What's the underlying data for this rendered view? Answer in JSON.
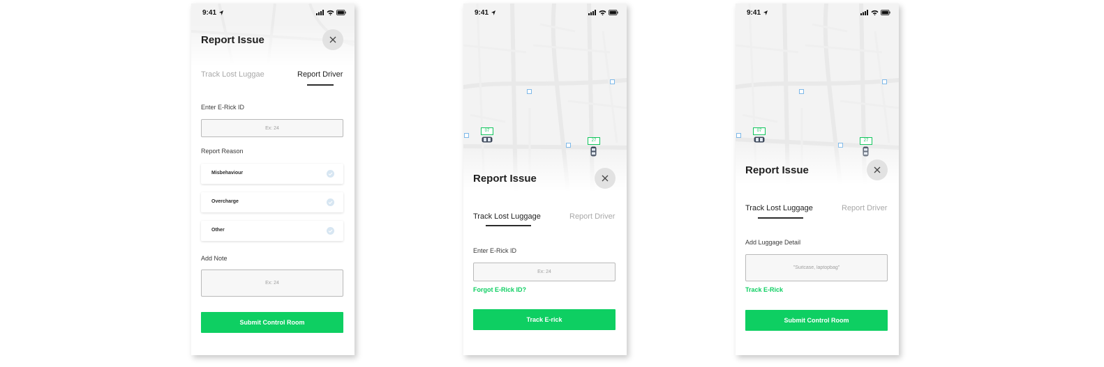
{
  "status_bar": {
    "time": "9:41"
  },
  "screen1": {
    "title": "Report Issue",
    "tabs": [
      {
        "label": "Track Lost Luggae",
        "active": false
      },
      {
        "label": "Report Driver",
        "active": true
      }
    ],
    "erick_id": {
      "label": "Enter E-Rick ID",
      "placeholder": "Ex: 24",
      "value": ""
    },
    "reason": {
      "label": "Report Reason",
      "options": [
        {
          "label": "Misbehaviour"
        },
        {
          "label": "Overcharge"
        },
        {
          "label": "Other"
        }
      ]
    },
    "note": {
      "label": "Add Note",
      "placeholder": "Ex: 24",
      "value": ""
    },
    "submit_label": "Submit Control Room"
  },
  "screen2": {
    "map_markers": [
      {
        "label": "07"
      },
      {
        "label": "27"
      }
    ],
    "title": "Report Issue",
    "tabs": [
      {
        "label": "Track Lost Luggage",
        "active": true
      },
      {
        "label": "Report Driver",
        "active": false
      }
    ],
    "erick_id": {
      "label": "Enter E-Rick ID",
      "placeholder": "Ex: 24",
      "value": ""
    },
    "forgot_link": "Forgot E-Rick ID?",
    "track_label": "Track E-rick"
  },
  "screen3": {
    "map_markers": [
      {
        "label": "07"
      },
      {
        "label": "27"
      }
    ],
    "title": "Report Issue",
    "tabs": [
      {
        "label": "Track Lost Luggage",
        "active": true
      },
      {
        "label": "Report Driver",
        "active": false
      }
    ],
    "luggage": {
      "label": "Add Luggage Detail",
      "placeholder": "\"Suitcase, laptopbag\"",
      "value": ""
    },
    "track_link": "Track E-Rick",
    "submit_label": "Submit Control Room"
  },
  "colors": {
    "accent_green": "#0ecf62",
    "close_bg": "#e2e2e2",
    "text_dark": "#1e1e1e",
    "text_muted": "#a8a8a8",
    "map_bg": "#f3f3f3"
  },
  "icons": [
    "location-arrow-icon",
    "cellular-signal-icon",
    "wifi-icon",
    "battery-icon",
    "close-icon",
    "check-circle-icon",
    "car-icon",
    "map-poi-icon"
  ]
}
